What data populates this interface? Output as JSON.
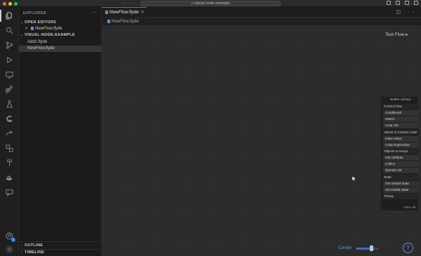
{
  "titlebar": {
    "search_text": "visual-node-example",
    "traffic_colors": [
      "#ff5f57",
      "#febc2e",
      "#28c840"
    ]
  },
  "activity_icons": [
    "files-icon",
    "search-icon",
    "source-control-icon",
    "run-debug-icon",
    "remote-explorer-icon",
    "extensions-icon",
    "testing-icon",
    "gitlens-icon",
    "live-share-icon",
    "docker-containers-icon",
    "flow-icon",
    "docker-icon",
    "comments-icon",
    "account-icon",
    "settings-gear-icon"
  ],
  "account_badge": "1",
  "sidebar": {
    "title": "EXPLORER",
    "more": "···",
    "open_editors_label": "OPEN EDITORS",
    "open_editor_file": "NewFlow.flyde",
    "project_label": "VISUAL-NODE-EXAMPLE",
    "files": [
      "Add1.flyde",
      "NewFlow.flyde"
    ],
    "outline_label": "OUTLINE",
    "timeline_label": "TIMELINE"
  },
  "editor": {
    "tab_label": "NewFlow.flyde",
    "tab_close": "×",
    "breadcrumb": "NewFlow.flyde",
    "test_flow_label": "Test Flow",
    "center_label": "Center",
    "help_label": "?",
    "zoom_fraction": 0.6
  },
  "nodes_library": {
    "title": "Nodes Library",
    "groups": [
      {
        "category": "Control Flow",
        "items": [
          "Conditional",
          "Switch",
          "Loop List"
        ]
      },
      {
        "category": "Values & Custom Code",
        "items": [
          "Inline Value",
          "Code Expression"
        ]
      },
      {
        "category": "Objects & Arrays",
        "items": [
          "Get Attribute",
          "Collect",
          "Spread List"
        ]
      },
      {
        "category": "State",
        "items": [
          "Get Global State",
          "Set Global State"
        ]
      },
      {
        "category": "Timing",
        "items": []
      }
    ],
    "view_all": "View all"
  },
  "colors": {
    "accent": "#3c83d6",
    "link": "#5e97e6",
    "badge": "#2f7bd8"
  }
}
